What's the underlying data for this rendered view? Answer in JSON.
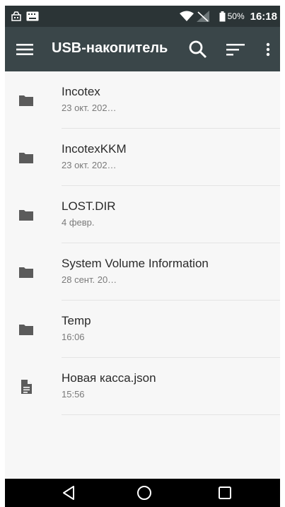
{
  "status_bar": {
    "battery": "50%",
    "time": "16:18",
    "icons": [
      "usb-debug-icon",
      "keyboard-icon",
      "wifi-icon",
      "no-signal-icon",
      "battery-icon"
    ]
  },
  "app_bar": {
    "title": "USB-накопитель",
    "icons": [
      "menu-icon",
      "search-icon",
      "sort-icon",
      "more-vert-icon"
    ]
  },
  "files": [
    {
      "name": "Incotex",
      "date": "23 окт. 202…",
      "type": "folder",
      "icon": "folder-icon"
    },
    {
      "name": "IncotexKKM",
      "date": "23 окт. 202…",
      "type": "folder",
      "icon": "folder-icon"
    },
    {
      "name": "LOST.DIR",
      "date": "4 февр.",
      "type": "folder",
      "icon": "folder-icon"
    },
    {
      "name": "System Volume Information",
      "date": "28 сент. 20…",
      "type": "folder",
      "icon": "folder-icon"
    },
    {
      "name": "Temp",
      "date": "16:06",
      "type": "folder",
      "icon": "folder-icon"
    },
    {
      "name": "Новая касса.json",
      "date": "15:56",
      "type": "file",
      "icon": "document-icon"
    }
  ],
  "nav_bar": {
    "icons": [
      "back-icon",
      "home-icon",
      "recent-apps-icon"
    ]
  },
  "colors": {
    "status_bar": "#2b3436",
    "app_bar": "#3a4649",
    "list_background": "#f7f7f7",
    "icon_gray": "#5b5b5b",
    "nav_bar": "#000000"
  }
}
